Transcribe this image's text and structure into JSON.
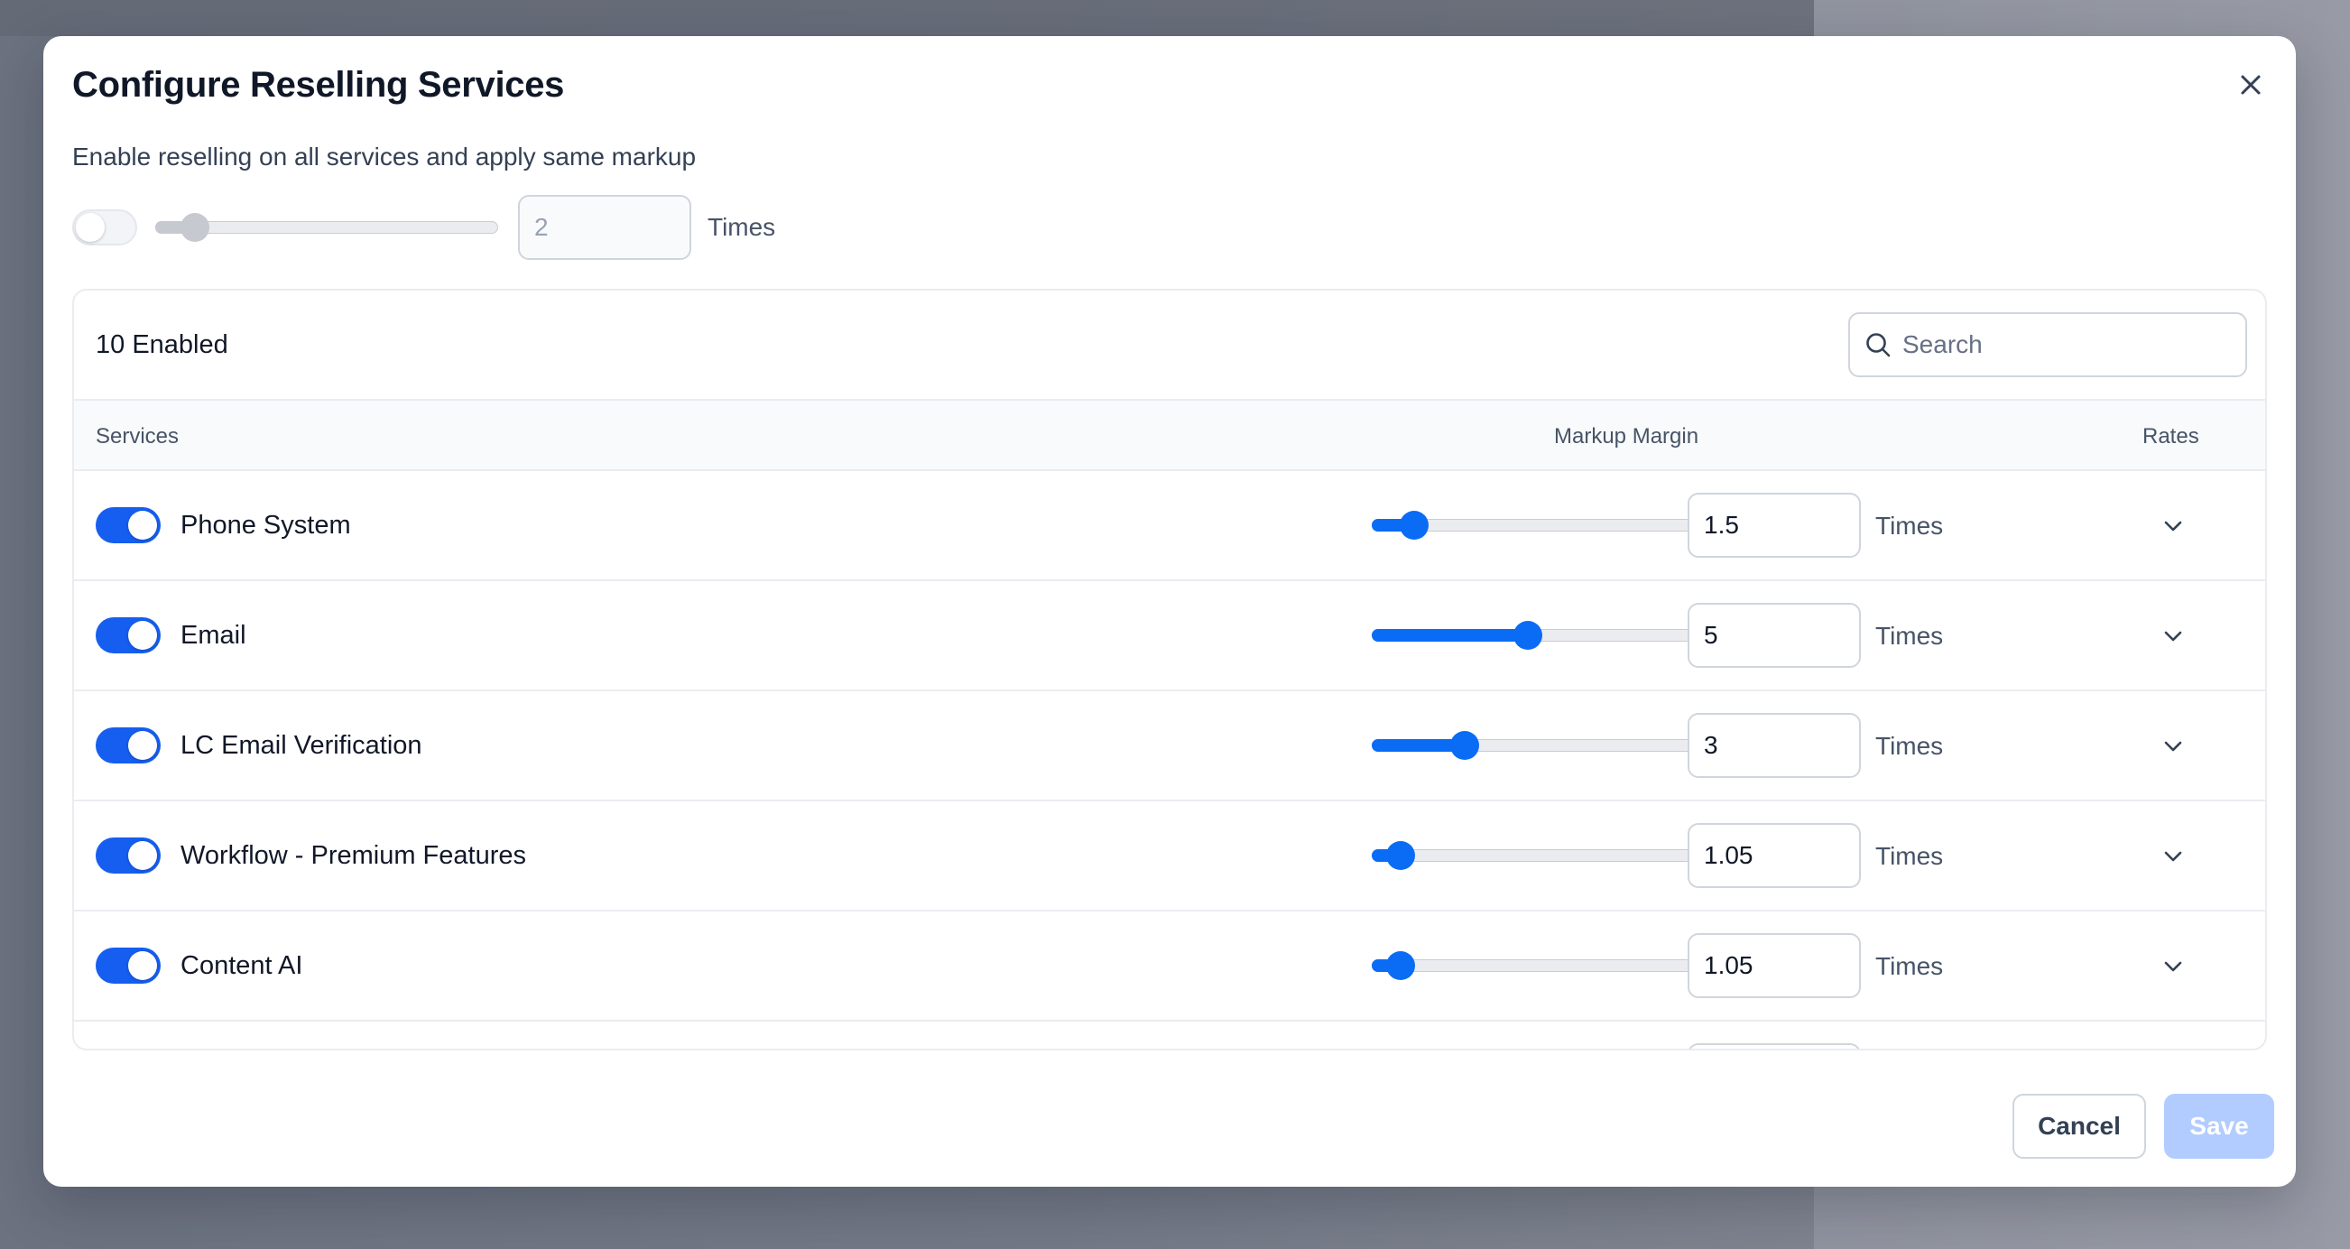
{
  "modal": {
    "title": "Configure Reselling Services",
    "subtitle": "Enable reselling on all services and apply same markup",
    "global": {
      "enabled": false,
      "markup_value": "2",
      "markup_fraction": 0.08,
      "unit": "Times"
    }
  },
  "table": {
    "enabled_count": "10 Enabled",
    "search": {
      "placeholder": "Search",
      "value": ""
    },
    "columns": {
      "services": "Services",
      "markup": "Markup Margin",
      "rates": "Rates"
    },
    "rows": [
      {
        "name": "Phone System",
        "enabled": true,
        "markup": "1.5",
        "slider_fraction": 0.09,
        "unit": "Times"
      },
      {
        "name": "Email",
        "enabled": true,
        "markup": "5",
        "slider_fraction": 0.45,
        "unit": "Times"
      },
      {
        "name": "LC Email Verification",
        "enabled": true,
        "markup": "3",
        "slider_fraction": 0.25,
        "unit": "Times"
      },
      {
        "name": "Workflow - Premium Features",
        "enabled": true,
        "markup": "1.05",
        "slider_fraction": 0.045,
        "unit": "Times"
      },
      {
        "name": "Content AI",
        "enabled": true,
        "markup": "1.05",
        "slider_fraction": 0.045,
        "unit": "Times"
      }
    ]
  },
  "footer": {
    "cancel_label": "Cancel",
    "save_label": "Save"
  },
  "colors": {
    "accent": "#0a6cf5",
    "toggle_on": "#155eef",
    "save_disabled": "#b2ccff"
  },
  "icons": {
    "close": "close-icon",
    "search": "search-icon",
    "row_expand": "chevron-down-icon"
  }
}
